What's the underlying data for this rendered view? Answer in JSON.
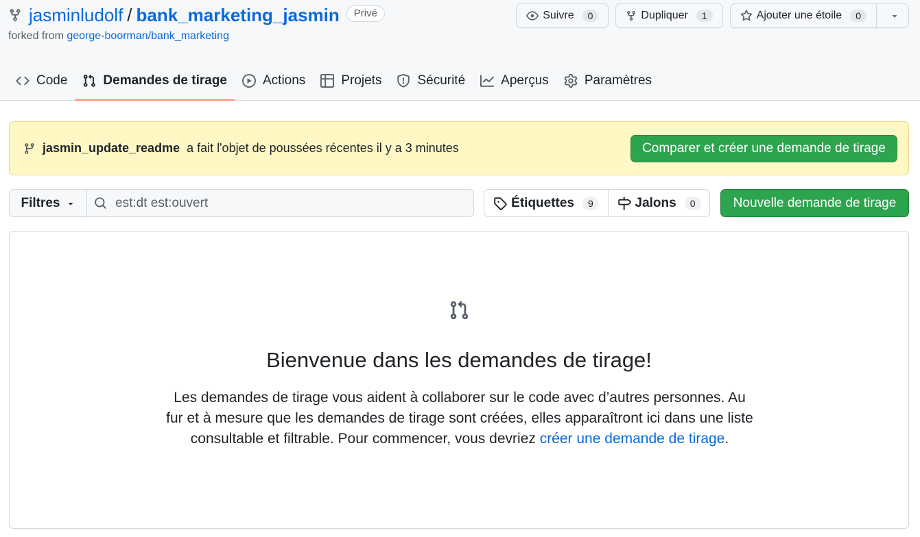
{
  "header": {
    "owner": "jasminludolf",
    "separator": "/",
    "repo": "bank_marketing_jasmin",
    "visibility": "Privé",
    "forked_prefix": "forked from",
    "forked_source": "george-boorman/bank_marketing",
    "watch": {
      "label": "Suivre",
      "count": "0"
    },
    "fork": {
      "label": "Dupliquer",
      "count": "1"
    },
    "star": {
      "label": "Ajouter une étoile",
      "count": "0"
    }
  },
  "tabs": [
    {
      "label": "Code",
      "icon": "code-icon"
    },
    {
      "label": "Demandes de tirage",
      "icon": "git-pull-request-icon",
      "active": true
    },
    {
      "label": "Actions",
      "icon": "play-icon"
    },
    {
      "label": "Projets",
      "icon": "table-icon"
    },
    {
      "label": "Sécurité",
      "icon": "shield-icon"
    },
    {
      "label": "Aperçus",
      "icon": "graph-icon"
    },
    {
      "label": "Paramètres",
      "icon": "gear-icon"
    }
  ],
  "banner": {
    "branch": "jasmin_update_readme",
    "message": "a fait l'objet de poussées récentes il y a 3 minutes",
    "button": "Comparer et créer une demande de tirage"
  },
  "filters": {
    "label": "Filtres",
    "search_value": "est:dt est:ouvert"
  },
  "labels": {
    "label": "Étiquettes",
    "count": "9"
  },
  "milestones": {
    "label": "Jalons",
    "count": "0"
  },
  "new_pr_button": "Nouvelle demande de tirage",
  "blankslate": {
    "title": "Bienvenue dans les demandes de tirage!",
    "desc_before": "Les demandes de tirage vous aident à collaborer sur le code avec d’autres personnes. Au fur et à mesure que les demandes de tirage sont créées, elles apparaîtront ici dans une liste consultable et filtrable. Pour commencer, vous devriez ",
    "desc_link": "créer une demande de tirage",
    "desc_after": "."
  },
  "colors": {
    "accent_link": "#0969da",
    "primary_button": "#2da44e",
    "banner_bg": "#fff8c5",
    "active_tab_underline": "#fd8c73"
  }
}
